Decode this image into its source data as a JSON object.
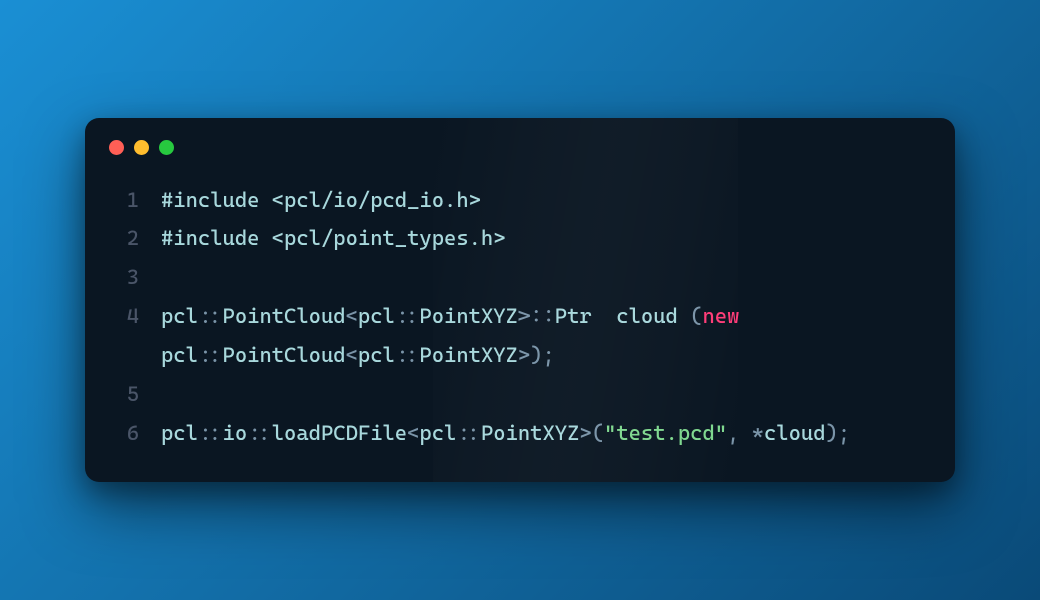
{
  "window": {
    "traffic_lights": [
      "red",
      "yellow",
      "green"
    ]
  },
  "syntax_colors": {
    "keyword": "#ff3c78",
    "string": "#7fd88f",
    "punct": "#7a94a8",
    "ident": "#a8d8dc",
    "line_number": "#4a5568",
    "background": "#0a1622"
  },
  "code": {
    "lines": [
      {
        "n": "1",
        "tokens": [
          {
            "t": "#include ",
            "c": "preproc"
          },
          {
            "t": "<pcl/io/pcd_io.h>",
            "c": "ident"
          }
        ]
      },
      {
        "n": "2",
        "tokens": [
          {
            "t": "#include ",
            "c": "preproc"
          },
          {
            "t": "<pcl/point_types.h>",
            "c": "ident"
          }
        ]
      },
      {
        "n": "3",
        "tokens": []
      },
      {
        "n": "4",
        "tokens": [
          {
            "t": "pcl",
            "c": "ident"
          },
          {
            "t": "::",
            "c": "punct"
          },
          {
            "t": "PointCloud",
            "c": "ident"
          },
          {
            "t": "<",
            "c": "punct"
          },
          {
            "t": "pcl",
            "c": "ident"
          },
          {
            "t": "::",
            "c": "punct"
          },
          {
            "t": "PointXYZ",
            "c": "ident"
          },
          {
            "t": ">::",
            "c": "punct"
          },
          {
            "t": "Ptr ",
            "c": "ident"
          },
          {
            "t": " cloud ",
            "c": "ident"
          },
          {
            "t": "(",
            "c": "punct"
          },
          {
            "t": "new",
            "c": "keyword"
          },
          {
            "t": " pcl",
            "c": "ident"
          },
          {
            "t": "::",
            "c": "punct"
          },
          {
            "t": "PointCloud",
            "c": "ident"
          },
          {
            "t": "<",
            "c": "punct"
          },
          {
            "t": "pcl",
            "c": "ident"
          },
          {
            "t": "::",
            "c": "punct"
          },
          {
            "t": "PointXYZ",
            "c": "ident"
          },
          {
            "t": ">);",
            "c": "punct"
          }
        ]
      },
      {
        "n": "5",
        "tokens": []
      },
      {
        "n": "6",
        "tokens": [
          {
            "t": "pcl",
            "c": "ident"
          },
          {
            "t": "::",
            "c": "punct"
          },
          {
            "t": "io",
            "c": "ident"
          },
          {
            "t": "::",
            "c": "punct"
          },
          {
            "t": "loadPCDFile",
            "c": "ident"
          },
          {
            "t": "<",
            "c": "punct"
          },
          {
            "t": "pcl",
            "c": "ident"
          },
          {
            "t": "::",
            "c": "punct"
          },
          {
            "t": "PointXYZ",
            "c": "ident"
          },
          {
            "t": ">",
            "c": "punct"
          },
          {
            "t": "(",
            "c": "punct"
          },
          {
            "t": "\"test.pcd\"",
            "c": "string"
          },
          {
            "t": ", *",
            "c": "punct"
          },
          {
            "t": "cloud",
            "c": "ident"
          },
          {
            "t": ");",
            "c": "punct"
          }
        ]
      }
    ]
  }
}
